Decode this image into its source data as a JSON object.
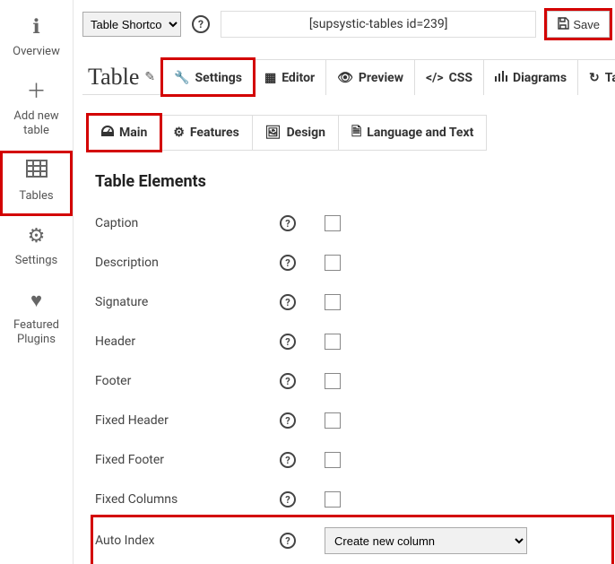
{
  "sidebar": {
    "items": [
      {
        "label": "Overview"
      },
      {
        "label": "Add new table"
      },
      {
        "label": "Tables"
      },
      {
        "label": "Settings"
      },
      {
        "label": "Featured Plugins"
      }
    ]
  },
  "topbar": {
    "dropdown_value": "Table Shortcode",
    "shortcode_text": "[supsystic-tables id=239]",
    "save_label": "Save"
  },
  "title": "Table",
  "tabs": {
    "settings": "Settings",
    "editor": "Editor",
    "preview": "Preview",
    "css": "CSS",
    "diagrams": "Diagrams",
    "table": "Tabl"
  },
  "subtabs": {
    "main": "Main",
    "features": "Features",
    "design": "Design",
    "language": "Language and Text"
  },
  "section_title": "Table Elements",
  "rows": {
    "caption": "Caption",
    "description": "Description",
    "signature": "Signature",
    "header": "Header",
    "footer": "Footer",
    "fixed_header": "Fixed Header",
    "fixed_footer": "Fixed Footer",
    "fixed_columns": "Fixed Columns",
    "auto_index": "Auto Index"
  },
  "auto_index_select": "Create new column"
}
